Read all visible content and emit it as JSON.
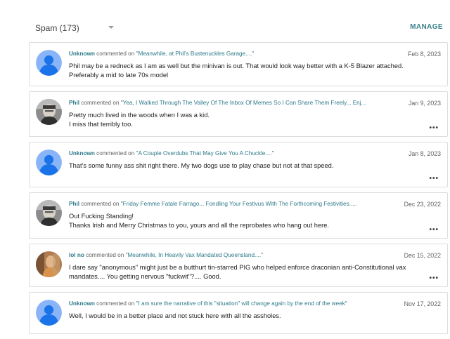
{
  "filter": {
    "label": "Spam (173)"
  },
  "manage_label": "MANAGE",
  "commented_on": "commented on",
  "comments": [
    {
      "author": "Unknown",
      "avatar": "default-person-icon",
      "post": "\"Meanwhile, at Phil's Bustenuckles Garage....\"",
      "date": "Feb 8, 2023",
      "lines": [
        "Phil may be a redneck as I am as well but the minivan is out. That would look way better with a K-5 Blazer attached.",
        "Preferably a mid to late 70s model"
      ],
      "more": ""
    },
    {
      "author": "Phil",
      "avatar": "phil-photo",
      "post": "\"Yea, I Walked Through The Valley Of The Inbox Of Memes So I Can Share Them Freely... Enj...",
      "date": "Jan 9, 2023",
      "lines": [
        "Pretty much lived in the woods when I was a kid.",
        "I miss that terribly too."
      ],
      "more": "•••"
    },
    {
      "author": "Unknown",
      "avatar": "default-person-icon",
      "post": "\"A Couple Overdubs That May Give You A Chuckle....\"",
      "date": "Jan 8, 2023",
      "lines": [
        "That's some funny ass shit right there. My two dogs use to play chase but not at that speed."
      ],
      "more": "•••"
    },
    {
      "author": "Phil",
      "avatar": "phil-photo",
      "post": "\"Friday Femme Fatale Farrago... Fondling Your Festivus With The Forthcoming Festivities.....",
      "date": "Dec 23, 2022",
      "lines": [
        "Out Fucking Standing!",
        "Thanks Irish and Merry Christmas to you, yours and all the reprobates who hang out here."
      ],
      "more": "•••"
    },
    {
      "author": "lol no",
      "avatar": "lolno-photo",
      "post": "\"Meanwhile, In Heavily Vax Mandated Queensland....\"",
      "date": "Dec 15, 2022",
      "lines": [
        "I dare say \"anonymous\" might just be a butthurt tin-starred PIG who helped enforce draconian anti-Constitutional vax mandates.... You getting nervous \"fuckwit\"?.... Good."
      ],
      "more": "•••"
    },
    {
      "author": "Unknown",
      "avatar": "default-person-icon",
      "post": "\"I am sure the narrative of this \"situation\" will change again by the end of the week\"",
      "date": "Nov 17, 2022",
      "lines": [
        "Well, I would be in a better place and not stuck here with all the assholes."
      ],
      "more": ""
    }
  ]
}
